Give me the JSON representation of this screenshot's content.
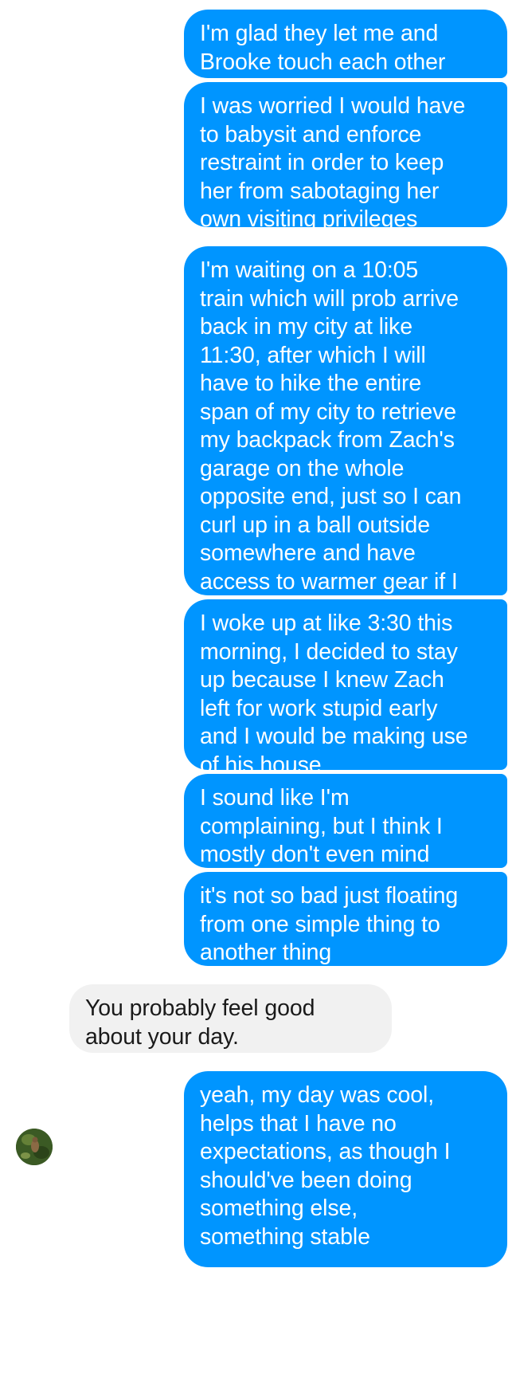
{
  "conversation": {
    "messages": [
      {
        "direction": "outgoing",
        "text": "I'm glad they let me and\nBrooke touch each other"
      },
      {
        "direction": "outgoing",
        "text": "I was worried I would have\nto babysit and enforce\nrestraint in order to keep\nher from sabotaging her\nown visiting privileges"
      },
      {
        "direction": "outgoing",
        "text": "I'm waiting on a 10:05\ntrain which will prob arrive\nback in my city at like\n11:30, after which I will\nhave to hike the entire\nspan of my city to retrieve\nmy backpack from Zach's\ngarage on the whole\nopposite end, just so I can\ncurl up in a ball outside\nsomewhere and have\naccess to warmer gear if I\nneed it"
      },
      {
        "direction": "outgoing",
        "text": "I woke up at like 3:30 this\nmorning, I decided to stay\nup because I knew Zach\nleft for work stupid early\nand I would be making use\nof his house"
      },
      {
        "direction": "outgoing",
        "text": "I sound like I'm\ncomplaining, but I think I\nmostly don't even mind"
      },
      {
        "direction": "outgoing",
        "text": "it's not so bad just floating\nfrom one simple thing to\nanother thing"
      },
      {
        "direction": "incoming",
        "text": "You probably feel good\nabout your day."
      },
      {
        "direction": "outgoing",
        "text": "yeah, my day was cool,\nhelps that I have no\nexpectations, as though I\nshould've been doing\nsomething else,\nsomething stable"
      }
    ]
  },
  "colors": {
    "outgoing_bubble": "#0095ff",
    "incoming_bubble": "#f1f1f1",
    "outgoing_text": "#ffffff",
    "incoming_text": "#1a1a1a"
  },
  "icons": {
    "contact_avatar": "avatar-photo"
  }
}
